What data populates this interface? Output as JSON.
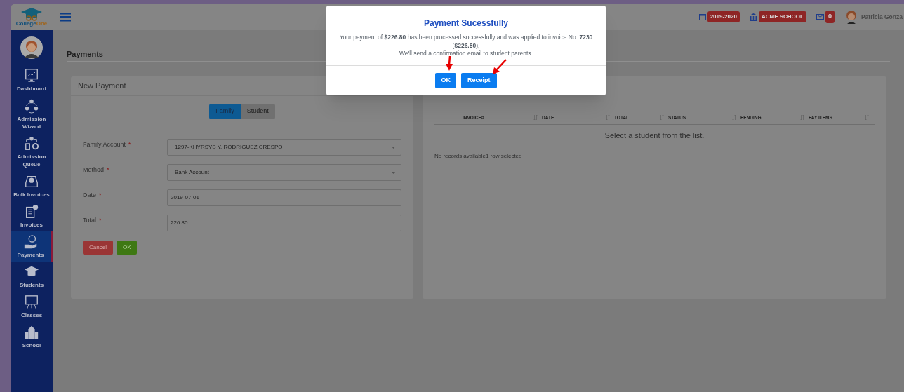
{
  "logo": {
    "parts": [
      "College",
      "One"
    ]
  },
  "topbar": {
    "school_year": "2019-2020",
    "school": "ACME SCHOOL",
    "messages": "0",
    "user": "Patricia Gonza"
  },
  "sidebar": {
    "items": [
      {
        "label": "Dashboard",
        "selected": false
      },
      {
        "label": "Admission Wizard",
        "selected": false
      },
      {
        "label": "Admission Queue",
        "selected": false
      },
      {
        "label": "Bulk Invoices",
        "selected": false
      },
      {
        "label": "Invoices",
        "selected": false
      },
      {
        "label": "Payments",
        "selected": true
      },
      {
        "label": "Students",
        "selected": false
      },
      {
        "label": "Classes",
        "selected": false
      },
      {
        "label": "School",
        "selected": false
      }
    ]
  },
  "page_title": "Payments",
  "new_payment": {
    "title": "New Payment",
    "toggle": [
      {
        "label": "Family",
        "selected": true
      },
      {
        "label": "Student",
        "selected": false
      }
    ],
    "fields": [
      {
        "label": "Family Account",
        "required_mark": "*",
        "kind": "select",
        "value": "1297-KHYRSYS Y. RODRIGUEZ CRESPO"
      },
      {
        "label": "Method",
        "required_mark": "*",
        "kind": "select",
        "value": "Bank Account"
      },
      {
        "label": "Date",
        "required_mark": "*",
        "kind": "text",
        "value": "2019-07-01"
      },
      {
        "label": "Total",
        "required_mark": "*",
        "kind": "text",
        "value": "226.80"
      }
    ],
    "buttons": [
      {
        "label": "Cancel",
        "kind": "danger"
      },
      {
        "label": "OK",
        "kind": "success"
      }
    ]
  },
  "invoices_table": {
    "columns": [
      "INVOICE#",
      "DATE",
      "TOTAL",
      "STATUS",
      "PENDING",
      "PAY ITEMS"
    ],
    "empty_message": "Select a student from the list.",
    "footer": "No records available1 row selected"
  },
  "modal": {
    "title": "Payment Sucessfully",
    "message": [
      "Your payment of **$226.80** has been processed successfully and was applied to invoice No. **7230** (**$226.80**),",
      "We'll send a confirmation email to student parents."
    ],
    "buttons": [
      "OK",
      "Receipt"
    ]
  }
}
